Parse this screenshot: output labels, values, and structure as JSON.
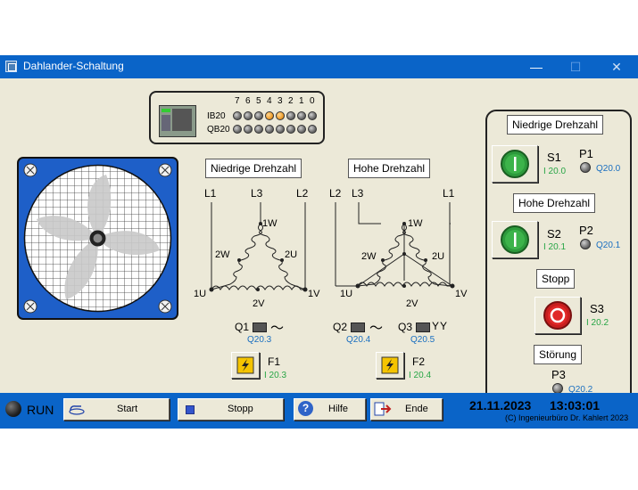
{
  "window": {
    "title": "Dahlander-Schaltung",
    "minimize": "—",
    "maximize": "☐",
    "close": "✕"
  },
  "plc": {
    "bits": [
      "7",
      "6",
      "5",
      "4",
      "3",
      "2",
      "1",
      "0"
    ],
    "ib_label": "IB20",
    "qb_label": "QB20",
    "ib_states": [
      0,
      0,
      0,
      1,
      1,
      0,
      0,
      0
    ],
    "qb_states": [
      0,
      0,
      0,
      0,
      0,
      0,
      0,
      0
    ],
    "on_color": "#f0a030"
  },
  "diagram_low": {
    "title": "Niedrige Drehzahl",
    "l1": "L1",
    "l2": "L2",
    "l3": "L3",
    "w1": "1W",
    "w2": "2W",
    "u2": "2U",
    "u1": "1U",
    "v1": "1V",
    "v2": "2V",
    "contactor": "Q1",
    "contactor_addr": "Q20.3",
    "symbol": "～",
    "fuse": "F1",
    "fuse_addr": "I 20.3"
  },
  "diagram_high": {
    "title": "Hohe Drehzahl",
    "l1": "L1",
    "l2": "L2",
    "l3": "L3",
    "w1": "1W",
    "w2": "2W",
    "u2": "2U",
    "u1": "1U",
    "v1": "1V",
    "v2": "2V",
    "q2": "Q2",
    "q2_addr": "Q20.4",
    "q2_symbol": "～",
    "q3": "Q3",
    "q3_addr": "Q20.5",
    "q3_symbol": "YY",
    "fuse": "F2",
    "fuse_addr": "I 20.4"
  },
  "control_panel": {
    "low_title": "Niedrige Drehzahl",
    "s1": "S1",
    "s1_addr": "I 20.0",
    "p1": "P1",
    "p1_addr": "Q20.0",
    "high_title": "Hohe Drehzahl",
    "s2": "S2",
    "s2_addr": "I 20.1",
    "p2": "P2",
    "p2_addr": "Q20.1",
    "stop_title": "Stopp",
    "s3": "S3",
    "s3_addr": "I 20.2",
    "fault_title": "Störung",
    "p3": "P3",
    "p3_addr": "Q20.2"
  },
  "bottom": {
    "run": "RUN",
    "start": "Start",
    "stop": "Stopp",
    "help": "Hilfe",
    "end": "Ende",
    "date": "21.11.2023",
    "time": "13:03:01",
    "copyright": "(C) Ingenieurbüro Dr. Kahlert 2023"
  },
  "colors": {
    "window_blue": "#0a64c8",
    "client_bg": "#ece9d8",
    "addr_blue": "#1a6fc0",
    "addr_green": "#27a545",
    "fan_blue": "#1e5fc8"
  }
}
